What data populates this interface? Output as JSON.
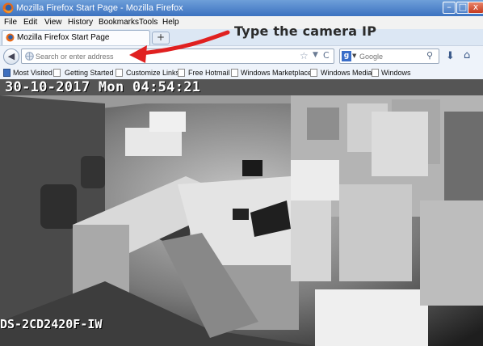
{
  "window": {
    "title": "Mozilla Firefox Start Page - Mozilla Firefox",
    "controls": {
      "minimize": "–",
      "maximize": "□",
      "close": "x"
    }
  },
  "menu": [
    "File",
    "Edit",
    "View",
    "History",
    "Bookmarks",
    "Tools",
    "Help"
  ],
  "tabs": [
    {
      "label": "Mozilla Firefox Start Page"
    }
  ],
  "new_tab_label": "+",
  "annotation": {
    "text": "Type the camera IP"
  },
  "nav": {
    "back_glyph": "◀",
    "url_placeholder": "Search or enter address",
    "search_engine": "g",
    "search_placeholder": "Google",
    "star_glyph": "☆",
    "reload_glyph": "C",
    "drop_glyph": "▼",
    "search_glyph": "⚲",
    "download_glyph": "⬇",
    "home_glyph": "⌂"
  },
  "bookmarks": [
    "Most Visited",
    "Getting Started",
    "Customize Links",
    "Free Hotmail",
    "Windows Marketplace",
    "Windows Media",
    "Windows"
  ],
  "camera": {
    "timestamp": "30-10-2017 Mon 04:54:21",
    "model": "DS-2CD2420F-IW"
  },
  "colors": {
    "titlebar": "#4a80cb",
    "annotation_arrow": "#e02020"
  }
}
